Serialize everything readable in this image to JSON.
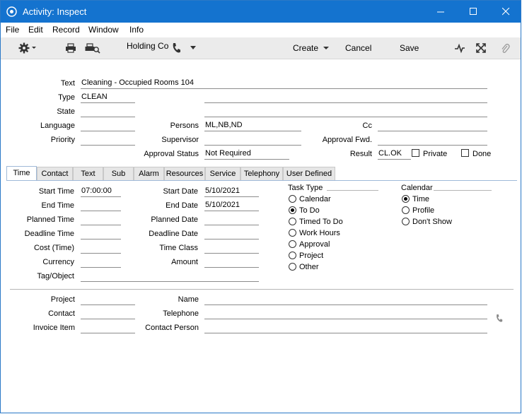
{
  "window": {
    "title": "Activity: Inspect",
    "colors": {
      "titlebar": "#1473cf",
      "toolbar": "#ebebeb"
    }
  },
  "menu": [
    "File",
    "Edit",
    "Record",
    "Window",
    "Info"
  ],
  "toolbar": {
    "company": "Holding Com",
    "create_label": "Create",
    "cancel_label": "Cancel",
    "save_label": "Save"
  },
  "header": {
    "text_label": "Text",
    "text_value": "Cleaning - Occupied Rooms 104",
    "type_label": "Type",
    "type_value": "CLEAN",
    "type_desc": "",
    "state_label": "State",
    "state_value": "",
    "state_desc": "",
    "language_label": "Language",
    "language_value": "",
    "persons_label": "Persons",
    "persons_value": "ML,NB,ND",
    "cc_label": "Cc",
    "cc_value": "",
    "priority_label": "Priority",
    "priority_value": "",
    "supervisor_label": "Supervisor",
    "supervisor_value": "",
    "approval_fwd_label": "Approval Fwd.",
    "approval_fwd_value": "",
    "approval_status_label": "Approval Status",
    "approval_status_value": "Not Required",
    "result_label": "Result",
    "result_value": "CL.OK",
    "private_label": "Private",
    "private_checked": false,
    "done_label": "Done",
    "done_checked": false
  },
  "tabs": [
    "Time",
    "Contact",
    "Text",
    "Sub",
    "Alarm",
    "Resources",
    "Service",
    "Telephony",
    "User Defined"
  ],
  "time_tab": {
    "start_time_label": "Start Time",
    "start_time_value": "07:00:00",
    "end_time_label": "End Time",
    "end_time_value": "",
    "planned_time_label": "Planned Time",
    "planned_time_value": "",
    "deadline_time_label": "Deadline Time",
    "deadline_time_value": "",
    "cost_time_label": "Cost (Time)",
    "cost_time_value": "",
    "currency_label": "Currency",
    "currency_value": "",
    "tag_object_label": "Tag/Object",
    "tag_object_value": "",
    "start_date_label": "Start Date",
    "start_date_value": "5/10/2021",
    "end_date_label": "End Date",
    "end_date_value": "5/10/2021",
    "planned_date_label": "Planned Date",
    "planned_date_value": "",
    "deadline_date_label": "Deadline Date",
    "deadline_date_value": "",
    "time_class_label": "Time Class",
    "time_class_value": "",
    "amount_label": "Amount",
    "amount_value": "",
    "task_type_label": "Task Type",
    "task_types": [
      "Calendar",
      "To Do",
      "Timed To Do",
      "Work Hours",
      "Approval",
      "Project",
      "Other"
    ],
    "task_type_selected": "To Do",
    "calendar_label": "Calendar",
    "calendar_options": [
      "Time",
      "Profile",
      "Don't Show"
    ],
    "calendar_selected": "Time"
  },
  "footer": {
    "project_label": "Project",
    "project_value": "",
    "name_label": "Name",
    "name_value": "",
    "contact_label": "Contact",
    "contact_value": "",
    "telephone_label": "Telephone",
    "telephone_value": "",
    "invoice_item_label": "Invoice Item",
    "invoice_item_value": "",
    "contact_person_label": "Contact Person",
    "contact_person_value": ""
  },
  "icons": [
    "app-icon",
    "gear-icon",
    "print-icon",
    "print-preview-icon",
    "phone-icon",
    "activity-icon",
    "expand-icon",
    "paperclip-icon"
  ]
}
